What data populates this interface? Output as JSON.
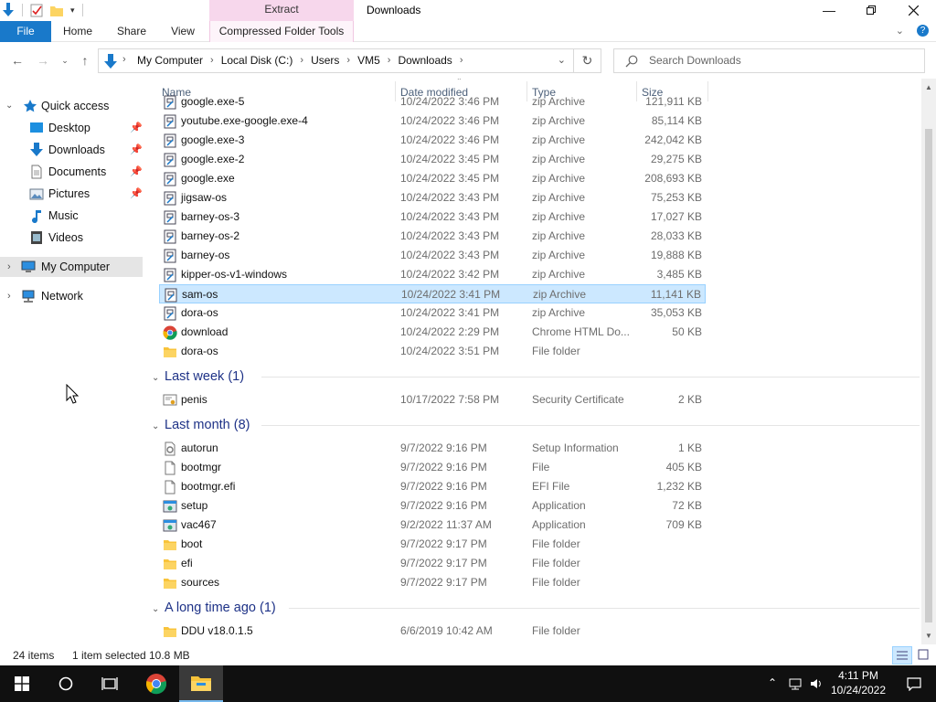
{
  "window": {
    "title": "Downloads",
    "context_tab_header": "Extract"
  },
  "ribbon": {
    "tabs": [
      {
        "label": "File"
      },
      {
        "label": "Home"
      },
      {
        "label": "Share"
      },
      {
        "label": "View"
      },
      {
        "label": "Compressed Folder Tools"
      }
    ]
  },
  "address": {
    "breadcrumbs": [
      "My Computer",
      "Local Disk (C:)",
      "Users",
      "VM5",
      "Downloads"
    ],
    "search_placeholder": "Search Downloads"
  },
  "nav": {
    "quick_access": "Quick access",
    "items": [
      {
        "label": "Desktop",
        "pinned": true
      },
      {
        "label": "Downloads",
        "pinned": true
      },
      {
        "label": "Documents",
        "pinned": true
      },
      {
        "label": "Pictures",
        "pinned": true
      },
      {
        "label": "Music",
        "pinned": false
      },
      {
        "label": "Videos",
        "pinned": false
      }
    ],
    "my_computer": "My Computer",
    "network": "Network"
  },
  "columns": {
    "name": "Name",
    "date": "Date modified",
    "type": "Type",
    "size": "Size"
  },
  "rows_earlier": [
    {
      "name": "google.exe-5",
      "date": "10/24/2022 3:46 PM",
      "type": "zip Archive",
      "size": "121,911 KB"
    },
    {
      "name": "youtube.exe-google.exe-4",
      "date": "10/24/2022 3:46 PM",
      "type": "zip Archive",
      "size": "85,114 KB"
    },
    {
      "name": "google.exe-3",
      "date": "10/24/2022 3:46 PM",
      "type": "zip Archive",
      "size": "242,042 KB"
    },
    {
      "name": "google.exe-2",
      "date": "10/24/2022 3:45 PM",
      "type": "zip Archive",
      "size": "29,275 KB"
    },
    {
      "name": "google.exe",
      "date": "10/24/2022 3:45 PM",
      "type": "zip Archive",
      "size": "208,693 KB"
    },
    {
      "name": "jigsaw-os",
      "date": "10/24/2022 3:43 PM",
      "type": "zip Archive",
      "size": "75,253 KB"
    },
    {
      "name": "barney-os-3",
      "date": "10/24/2022 3:43 PM",
      "type": "zip Archive",
      "size": "17,027 KB"
    },
    {
      "name": "barney-os-2",
      "date": "10/24/2022 3:43 PM",
      "type": "zip Archive",
      "size": "28,033 KB"
    },
    {
      "name": "barney-os",
      "date": "10/24/2022 3:43 PM",
      "type": "zip Archive",
      "size": "19,888 KB"
    },
    {
      "name": "kipper-os-v1-windows",
      "date": "10/24/2022 3:42 PM",
      "type": "zip Archive",
      "size": "3,485 KB"
    },
    {
      "name": "sam-os",
      "date": "10/24/2022 3:41 PM",
      "type": "zip Archive",
      "size": "11,141 KB"
    },
    {
      "name": "dora-os",
      "date": "10/24/2022 3:41 PM",
      "type": "zip Archive",
      "size": "35,053 KB"
    },
    {
      "name": "download",
      "date": "10/24/2022 2:29 PM",
      "type": "Chrome HTML Do...",
      "size": "50 KB"
    },
    {
      "name": "dora-os",
      "date": "10/24/2022 3:51 PM",
      "type": "File folder",
      "size": ""
    }
  ],
  "group_last_week": "Last week (1)",
  "rows_last_week": [
    {
      "name": "penis",
      "date": "10/17/2022 7:58 PM",
      "type": "Security Certificate",
      "size": "2 KB"
    }
  ],
  "group_last_month": "Last month (8)",
  "rows_last_month": [
    {
      "name": "autorun",
      "date": "9/7/2022 9:16 PM",
      "type": "Setup Information",
      "size": "1 KB"
    },
    {
      "name": "bootmgr",
      "date": "9/7/2022 9:16 PM",
      "type": "File",
      "size": "405 KB"
    },
    {
      "name": "bootmgr.efi",
      "date": "9/7/2022 9:16 PM",
      "type": "EFI File",
      "size": "1,232 KB"
    },
    {
      "name": "setup",
      "date": "9/7/2022 9:16 PM",
      "type": "Application",
      "size": "72 KB"
    },
    {
      "name": "vac467",
      "date": "9/2/2022 11:37 AM",
      "type": "Application",
      "size": "709 KB"
    },
    {
      "name": "boot",
      "date": "9/7/2022 9:17 PM",
      "type": "File folder",
      "size": ""
    },
    {
      "name": "efi",
      "date": "9/7/2022 9:17 PM",
      "type": "File folder",
      "size": ""
    },
    {
      "name": "sources",
      "date": "9/7/2022 9:17 PM",
      "type": "File folder",
      "size": ""
    }
  ],
  "group_long_ago": "A long time ago (1)",
  "rows_long_ago": [
    {
      "name": "DDU v18.0.1.5",
      "date": "6/6/2019 10:42 AM",
      "type": "File folder",
      "size": ""
    }
  ],
  "status": {
    "item_count": "24 items",
    "selected": "1 item selected",
    "selected_size": "10.8 MB"
  },
  "taskbar": {
    "time": "4:11 PM",
    "date": "10/24/2022"
  },
  "colors": {
    "accent": "#1979ca",
    "selection": "#cce8ff",
    "group_header": "#1e3287",
    "context_tab": "#f7d7ec"
  }
}
